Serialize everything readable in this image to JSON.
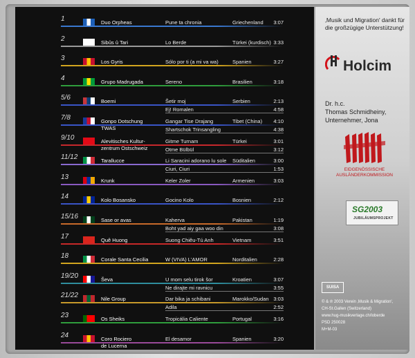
{
  "tracks": [
    {
      "num": "1",
      "artist": "Duo Orpheas",
      "title": "Pune ta chronia",
      "country": "Griechenland",
      "time": "3:07",
      "color": "#3a78d0",
      "flag": [
        "#1d5fb8",
        "#ffffff",
        "#1d5fb8"
      ]
    },
    {
      "num": "2",
      "artist": "Sibûs û Tari",
      "title": "Lo Berde",
      "country": "Türkei (kurdisch)",
      "time": "3:33",
      "color": "#9a9a9a",
      "flag": [
        "#ffffff",
        "#ffffff",
        "#ffffff"
      ]
    },
    {
      "num": "3",
      "artist": "Los Gyris",
      "title": "Sólo por ti (a mi va wa)",
      "country": "Spanien",
      "time": "3:27",
      "color": "#d2a51f",
      "flag": [
        "#c8102e",
        "#ffc400",
        "#c8102e"
      ]
    },
    {
      "num": "4",
      "artist": "Grupo Madrugada",
      "title": "Sereno",
      "country": "Brasilien",
      "time": "3:18",
      "color": "#2f9e3c",
      "flag": [
        "#009b3a",
        "#fedf00",
        "#009b3a"
      ]
    },
    {
      "num": "5/6",
      "artist": "Boemi",
      "title": "Šetir moj",
      "title2": "Ej! Romalen",
      "country": "Serbien",
      "time": "2:13",
      "time2": "4:58",
      "color": "#3a55c8",
      "flag": [
        "#c6363c",
        "#0c4076",
        "#ffffff"
      ]
    },
    {
      "num": "7/8",
      "artist": "Gonpo Dotschung",
      "artist2": "TWAS",
      "title": "Gangar Tise Drajang",
      "title2": "Shartschok Trinsangling",
      "country": "Tibet (China)",
      "time": "4:10",
      "time2": "4:38",
      "color": "#3a55c8",
      "flag": [
        "#1a3a9a",
        "#c8102e",
        "#ffffff"
      ]
    },
    {
      "num": "9/10",
      "artist": "Alevitisches Kultur-",
      "artist2": "zentrum Ostschweiz",
      "title": "Gitme Turnam",
      "title2": "Otme Bülbül",
      "country": "Türkei",
      "time": "3:01",
      "time2": "3:12",
      "color": "#c8282c",
      "flag": [
        "#e30a17",
        "#e30a17",
        "#e30a17"
      ]
    },
    {
      "num": "11/12",
      "artist": "Tarallucce",
      "title": "Li Saracini adorano lu sole",
      "title2": "Ciuri, Ciuri",
      "country": "Süditalien",
      "time": "3:00",
      "time2": "1:53",
      "color": "#8a6ad0",
      "flag": [
        "#009246",
        "#ffffff",
        "#ce2b37"
      ]
    },
    {
      "num": "13",
      "artist": "Krunk",
      "title": "Keler Zoler",
      "country": "Armenien",
      "time": "3:03",
      "color": "#8a5ac0",
      "flag": [
        "#d90012",
        "#0033a0",
        "#f2a800"
      ]
    },
    {
      "num": "14",
      "artist": "Kolo Bosansko",
      "title": "Gocino Kolo",
      "country": "Bosnien",
      "time": "2:12",
      "color": "#3a55c8",
      "flag": [
        "#002395",
        "#fecb00",
        "#002395"
      ]
    },
    {
      "num": "15/16",
      "artist": "Sase or avas",
      "title": "Kaherva",
      "title2": "Boht yad aiy gaa woo din",
      "country": "Pakistan",
      "time": "1:19",
      "time2": "3:08",
      "color": "#c86a2a",
      "flag": [
        "#01411c",
        "#ffffff",
        "#01411c"
      ]
    },
    {
      "num": "17",
      "artist": "Quê Huong",
      "title": "Suong Chiêu-Tú Anh",
      "country": "Vietnam",
      "time": "3:51",
      "color": "#c82828",
      "flag": [
        "#da251d",
        "#da251d",
        "#da251d"
      ]
    },
    {
      "num": "18",
      "artist": "Corale Santa Cecilia",
      "title": "W (VIVA) L'AMOR",
      "country": "Norditalien",
      "time": "2:28",
      "color": "#d2a51f",
      "flag": [
        "#009246",
        "#ffffff",
        "#ce2b37"
      ]
    },
    {
      "num": "19/20",
      "artist": "Ševa",
      "title": "U mom selu tirok šor",
      "title2": "Ne dirajte mi ravnicu",
      "country": "Kroatien",
      "time": "3:07",
      "time2": "3:55",
      "color": "#2f8e9e",
      "flag": [
        "#ff0000",
        "#ffffff",
        "#171796"
      ]
    },
    {
      "num": "21/22",
      "artist": "Nile Group",
      "title": "Dar bika ja schibani",
      "title2": "Adila",
      "country": "Marokko/Sudan",
      "time": "3:03",
      "time2": "2:52",
      "color": "#c89a2a",
      "flag": [
        "#c1272d",
        "#006233",
        "#c1272d"
      ]
    },
    {
      "num": "23",
      "artist": "Os Sheiks",
      "title": "Tropicália Caliente",
      "country": "Portugal",
      "time": "3:16",
      "color": "#2f9e3c",
      "flag": [
        "#006600",
        "#ff0000",
        "#ff0000"
      ]
    },
    {
      "num": "24",
      "artist": "Coro Rociero",
      "artist2": "de Lucerna",
      "title": "El desamor",
      "country": "Spanien",
      "time": "3:20",
      "color": "#9a4a9a",
      "flag": [
        "#c8102e",
        "#ffc400",
        "#c8102e"
      ]
    }
  ],
  "sidebar": {
    "thanks": "‚Musik und Migration' dankt für die großzügige Unterstützung!",
    "holcim": "Holcim",
    "sponsor_line1": "Dr. h.c.",
    "sponsor_line2": "Thomas Schmidheiny,",
    "sponsor_line3": "Unternehmer, Jona",
    "ekc_line1": "EIDGENÖSSISCHE",
    "ekc_line2": "AUSLÄNDERKOMMISSION",
    "sg_logo": "SG2003",
    "sg_sub": "JUBILÄUMSPROJEKT",
    "suisa": "SUISA",
    "credits": [
      "© & ℗ 2003 Verein ‚Musik & Migration',",
      "CH-St.Gallen (Switzerland)",
      "www.hug-musikverlage.ch/loberde",
      "PSD 250028",
      "M+M-03"
    ]
  },
  "colors": {
    "inlay": "#101010",
    "holcim_red": "#d2121a",
    "ekc_red": "#c0181c"
  }
}
